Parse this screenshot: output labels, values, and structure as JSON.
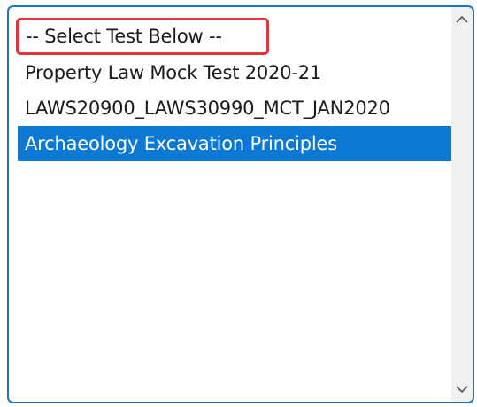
{
  "listbox": {
    "label": "Test selection list",
    "options": [
      {
        "label": "-- Select Test Below --"
      },
      {
        "label": "Property Law Mock Test 2020-21"
      },
      {
        "label": "LAWS20900_LAWS30990_MCT_JAN2020"
      },
      {
        "label": "Archaeology Excavation Principles"
      }
    ],
    "selected_index": 3,
    "highlighted_index": 0
  },
  "colors": {
    "border": "#1674c9",
    "selected_background": "#0b78d4",
    "highlight_outline": "#e0353a"
  },
  "icons": {
    "scroll_up": "chevron-up-icon",
    "scroll_down": "chevron-down-icon"
  }
}
